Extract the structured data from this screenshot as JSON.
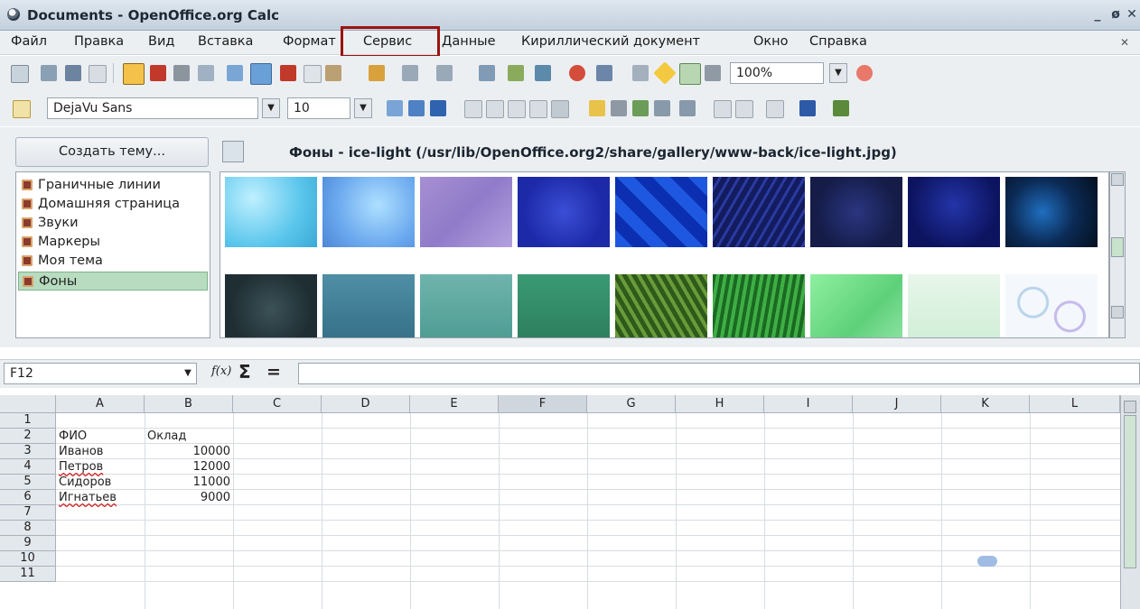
{
  "window": {
    "title": "Documents - OpenOffice.org Calc",
    "minimize": "_",
    "maximize": "ø",
    "close": "✕"
  },
  "menu": {
    "items": [
      "Файл",
      "Правка",
      "Вид",
      "Вставка",
      "Формат",
      "Сервис",
      "Данные",
      "Кириллический документ",
      "Окно",
      "Справка"
    ],
    "close_doc": "✕",
    "highlighted": "Сервис"
  },
  "toolbar": {
    "zoom": "100%"
  },
  "format_bar": {
    "font_name": "DejaVu Sans",
    "font_size": "10"
  },
  "gallery": {
    "create_theme_label": "Создать тему...",
    "path": "Фоны - ice-light (/usr/lib/OpenOffice.org2/share/gallery/www-back/ice-light.jpg)",
    "themes": [
      "Граничные линии",
      "Домашняя страница",
      "Звуки",
      "Маркеры",
      "Моя тема",
      "Фоны"
    ],
    "selected_theme": "Фоны"
  },
  "formula": {
    "cell_ref": "F12",
    "fx": "f(x)",
    "sum": "Σ",
    "equals": "="
  },
  "sheet": {
    "columns": [
      "A",
      "B",
      "C",
      "D",
      "E",
      "F",
      "G",
      "H",
      "I",
      "J",
      "K",
      "L"
    ],
    "active_column": "F",
    "rows": [
      "1",
      "2",
      "3",
      "4",
      "5",
      "6",
      "7",
      "8",
      "9",
      "10",
      "11"
    ],
    "cells": {
      "A2": "ФИО",
      "B2": "Оклад",
      "A3": "Иванов",
      "B3": "10000",
      "A4": "Петров",
      "B4": "12000",
      "A5": "Сидоров",
      "B5": "11000",
      "A6": "Игнатьев",
      "B6": "9000"
    }
  },
  "colors": {
    "highlight_box": "#9b1410",
    "selected_theme_bg": "#b8dcc0"
  }
}
